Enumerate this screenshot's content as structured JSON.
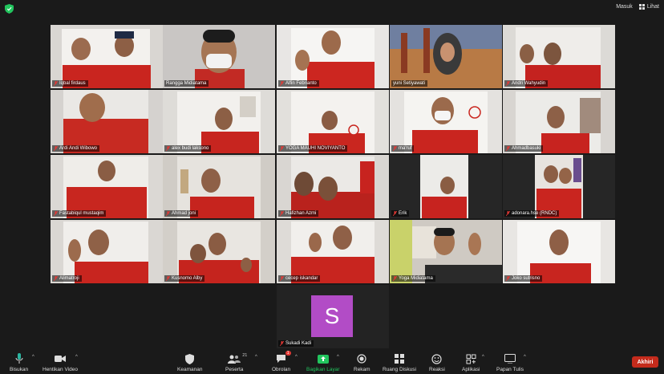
{
  "top": {
    "signin_label": "Masuk",
    "view_label": "Lihat"
  },
  "participants": [
    {
      "name": "Iqbal firdaus"
    },
    {
      "name": "Rangga Midiatama"
    },
    {
      "name": "Alfin Febrianto"
    },
    {
      "name": "yuni Setiyawati"
    },
    {
      "name": "Andri Wahyudin"
    },
    {
      "name": "Ardi Andi Wibowo"
    },
    {
      "name": "alex budi laksono"
    },
    {
      "name": "YOGA MAUHI NOVIYANTO"
    },
    {
      "name": "ma'ruf"
    },
    {
      "name": "Ahmadbasuki"
    },
    {
      "name": "Fastabiqul mustaqim"
    },
    {
      "name": "Ahmad joni"
    },
    {
      "name": "Hafizhan Azmi"
    },
    {
      "name": "Erik"
    },
    {
      "name": "adonara.hse (RNDC)"
    },
    {
      "name": "Alimatroji"
    },
    {
      "name": "Kusnomo Alby"
    },
    {
      "name": "cecep iskandar"
    },
    {
      "name": "Yoga Midiatama"
    },
    {
      "name": "Joko sutrisno"
    }
  ],
  "avatar_participant": {
    "name": "Sukadi Kadi",
    "initial": "S",
    "color": "#b24cc6"
  },
  "toolbar": {
    "unmute": "Bisukan",
    "stop_video": "Hentikan Video",
    "security": "Keamanan",
    "participants": "Peserta",
    "participants_count": "21",
    "chat": "Obrolan",
    "chat_badge": "1",
    "share": "Bagikan Layar",
    "record": "Rekam",
    "breakout": "Ruang Diskusi",
    "reactions": "Reaksi",
    "apps": "Aplikasi",
    "whiteboard": "Papan Tulis",
    "end": "Akhiri"
  }
}
